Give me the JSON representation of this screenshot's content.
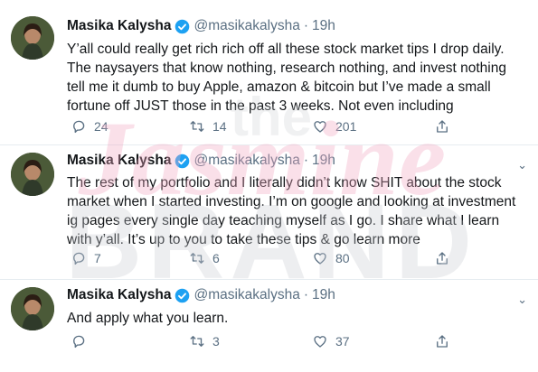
{
  "watermark": {
    "line1": "the",
    "line2": "Jasmine",
    "line3": "BRAND"
  },
  "tweets": [
    {
      "name": "Masika Kalysha",
      "handle": "@masikakalysha",
      "separator": "·",
      "time": "19h",
      "lines": [
        "Y’all could really get rich rich off all these stock market tips I drop daily.",
        "The naysayers that know nothing, research nothing, and invest nothing",
        "tell me it dumb to buy Apple, amazon & bitcoin but I’ve made a small",
        "fortune off JUST those in the past 3 weeks. Not even including"
      ],
      "replies": "24",
      "retweets": "14",
      "likes": "201"
    },
    {
      "name": "Masika Kalysha",
      "handle": "@masikakalysha",
      "separator": "·",
      "time": "19h",
      "lines": [
        "The rest of my portfolio and I literally didn’t know SHIT about the stock",
        "market when I started investing. I’m on google and looking at investment",
        "ig pages every single day teaching myself as I go. I share what I learn",
        "with y’all. It’s up to you to take these tips & go learn more"
      ],
      "replies": "7",
      "retweets": "6",
      "likes": "80"
    },
    {
      "name": "Masika Kalysha",
      "handle": "@masikakalysha",
      "separator": "·",
      "time": "19h",
      "lines": [
        "And apply what you learn."
      ],
      "replies": "",
      "retweets": "3",
      "likes": "37"
    }
  ],
  "colors": {
    "verified": "#1da1f2",
    "muted": "#5b7083",
    "text": "#14171a",
    "watermark_pink": "#f0a6c0"
  }
}
